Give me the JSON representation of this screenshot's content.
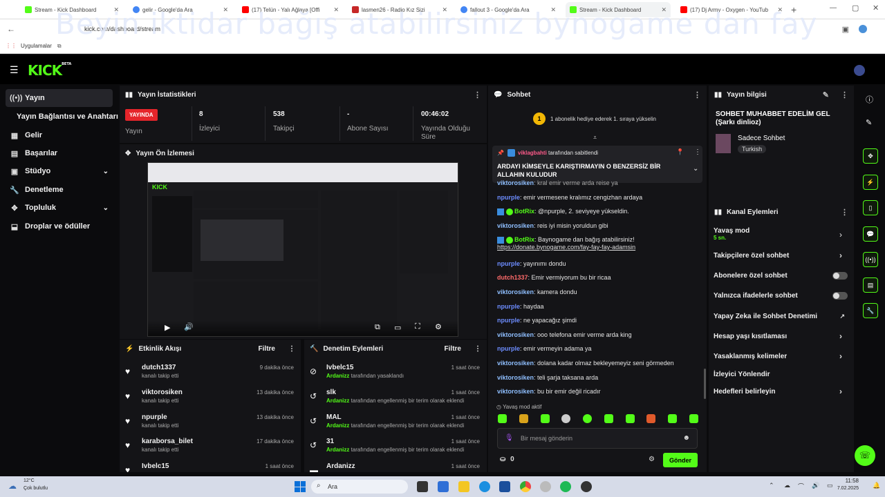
{
  "browser": {
    "tabs": [
      {
        "title": "Stream - Kick Dashboard",
        "color": "#53fc18"
      },
      {
        "title": "gelir - Google'da Ara",
        "color": "#4285f4"
      },
      {
        "title": "(17) Telün - Yalı Ağlaya [Offi",
        "color": "#ff0000"
      },
      {
        "title": "lasmen26 - Radio Kız Sizi",
        "color": "#c62828"
      },
      {
        "title": "fallout 3 - Google'da Ara",
        "color": "#4285f4"
      },
      {
        "title": "Stream - Kick Dashboard",
        "color": "#53fc18"
      },
      {
        "title": "(17) Dj Army - Oxygen - YouTub",
        "color": "#ff0000"
      }
    ],
    "url": "kick.com/dashboard/stream",
    "bookmark": "Uygulamalar",
    "overlay": "Beyin iktidar bağış atabilirsiniz bynogame dan fay"
  },
  "kick": {
    "logo": "KICK",
    "logo_sup": "BETA"
  },
  "sidebar": {
    "items": [
      {
        "label": "Yayın",
        "icon": "stream-icon"
      },
      {
        "label": "Yayın Bağlantısı ve Anahtarı",
        "icon": ""
      },
      {
        "label": "Gelir",
        "icon": "revenue-icon"
      },
      {
        "label": "Başarılar",
        "icon": "achievements-icon"
      },
      {
        "label": "Stüdyo",
        "icon": "studio-icon"
      },
      {
        "label": "Denetleme",
        "icon": "wrench-icon"
      },
      {
        "label": "Topluluk",
        "icon": "community-icon"
      },
      {
        "label": "Droplar ve ödüller",
        "icon": "drops-icon"
      }
    ]
  },
  "stats": {
    "title": "Yayın İstatistikleri",
    "live": "YAYINDA",
    "live_label": "Yayın",
    "viewers": "8",
    "viewers_label": "İzleyici",
    "followers": "538",
    "followers_label": "Takipçi",
    "subs": "-",
    "subs_label": "Abone Sayısı",
    "duration": "00:46:02",
    "duration_label": "Yayında Olduğu Süre"
  },
  "preview": {
    "title": "Yayın Ön İzlemesi"
  },
  "activity": {
    "title": "Etkinlik Akışı",
    "filter": "Filtre",
    "items": [
      {
        "name": "dutch1337",
        "sub": "kanalı takip etti",
        "time": "9 dakika önce"
      },
      {
        "name": "viktorosiken",
        "sub": "kanalı takip etti",
        "time": "13 dakika önce"
      },
      {
        "name": "npurple",
        "sub": "kanalı takip etti",
        "time": "13 dakika önce"
      },
      {
        "name": "karaborsa_bilet",
        "sub": "kanalı takip etti",
        "time": "17 dakika önce"
      },
      {
        "name": "Ivbelc15",
        "sub": "",
        "time": "1 saat önce"
      }
    ]
  },
  "moderation": {
    "title": "Denetim Eylemleri",
    "filter": "Filtre",
    "items": [
      {
        "name": "Ivbelc15",
        "actor": "Ardanizz",
        "text": "tarafından yasaklandı",
        "time": "1 saat önce"
      },
      {
        "name": "slk",
        "actor": "Ardanizz",
        "text": "tarafından engellenmiş bir terim olarak eklendi",
        "time": "1 saat önce"
      },
      {
        "name": "MAL",
        "actor": "Ardanizz",
        "text": "tarafından engellenmiş bir terim olarak eklendi",
        "time": "1 saat önce"
      },
      {
        "name": "31",
        "actor": "Ardanizz",
        "text": "tarafından engellenmiş bir terim olarak eklendi",
        "time": "1 saat önce"
      },
      {
        "name": "Ardanizz",
        "actor": "",
        "text": "",
        "time": "1 saat önce"
      }
    ]
  },
  "chat": {
    "title": "Sohbet",
    "gift_count": "1",
    "gift_text": "1 abonelik hediye ederek 1. sıraya yükselin",
    "pinned_by": "viklagbahti",
    "pinned_suffix": "tarafından sabitlendi",
    "pinned_text": "ARDAYI KİMSEYLE KARIŞTIRMAYIN O BENZERSİZ BİR ALLAHIN KULUDUR",
    "messages": [
      {
        "user": "viktorosiken",
        "color": "#8fbfff",
        "text": "kral emir verme arda reise ya"
      },
      {
        "user": "npurple",
        "color": "#6d8dff",
        "text": "emir vermesene kralımız cengizhan ardaya"
      },
      {
        "user": "BotRix",
        "color": "#53fc18",
        "text": "@npurple, 2. seviyeye yükseldin.",
        "bot": true
      },
      {
        "user": "viktorosiken",
        "color": "#8fbfff",
        "text": "reis iyi misin yoruldun gibi"
      },
      {
        "user": "BotRix",
        "color": "#53fc18",
        "text": "Baynogame dan bağış atabilirsiniz!",
        "link": "https://donate.bynogame.com/fay-fay-fay-adamsin",
        "bot": true
      },
      {
        "user": "npurple",
        "color": "#6d8dff",
        "text": "yayınımı dondu"
      },
      {
        "user": "dutch1337",
        "color": "#ff6b6b",
        "text": "Emir vermiyorum bu bir ricaa"
      },
      {
        "user": "viktorosiken",
        "color": "#8fbfff",
        "text": "kamera dondu"
      },
      {
        "user": "npurple",
        "color": "#6d8dff",
        "text": "haydaa"
      },
      {
        "user": "npurple",
        "color": "#6d8dff",
        "text": "ne yapacağız şimdi"
      },
      {
        "user": "viktorosiken",
        "color": "#8fbfff",
        "text": "ooo telefona emir verme arda king"
      },
      {
        "user": "npurple",
        "color": "#6d8dff",
        "text": "emir vermeyin adama ya"
      },
      {
        "user": "viktorosiken",
        "color": "#8fbfff",
        "text": "dolana kadar olmaz bekleyemeyiz seni görmeden"
      },
      {
        "user": "viktorosiken",
        "color": "#8fbfff",
        "text": "teli şarja taksana arda"
      },
      {
        "user": "viktorosiken",
        "color": "#8fbfff",
        "text": "bu bir emir değil ricadır"
      }
    ],
    "slow_mode": "Yavaş mod aktif",
    "input_placeholder": "Bir mesaj gönderin",
    "points": "0",
    "send": "Gönder"
  },
  "info": {
    "title": "Yayın bilgisi",
    "stream_title": "SOHBET MUHABBET EDELİM GEL (Şarkı dinlioz)",
    "category": "Sadece Sohbet",
    "language": "Turkish"
  },
  "channel": {
    "title": "Kanal Eylemleri",
    "slow": "Yavaş mod",
    "slow_value": "5 sn.",
    "items": [
      "Takipçilere özel sohbet",
      "Abonelere özel sohbet",
      "Yalnızca ifadelerle sohbet",
      "Yapay Zeka ile Sohbet Denetimi",
      "Hesap yaşı kısıtlaması",
      "Yasaklanmış kelimeler",
      "İzleyici Yönlendir",
      "Hedefleri belirleyin"
    ]
  },
  "taskbar": {
    "weather_temp": "12°C",
    "weather_desc": "Çok bulutlu",
    "search": "Ara",
    "time": "11:58",
    "date": "7.02.2025"
  }
}
